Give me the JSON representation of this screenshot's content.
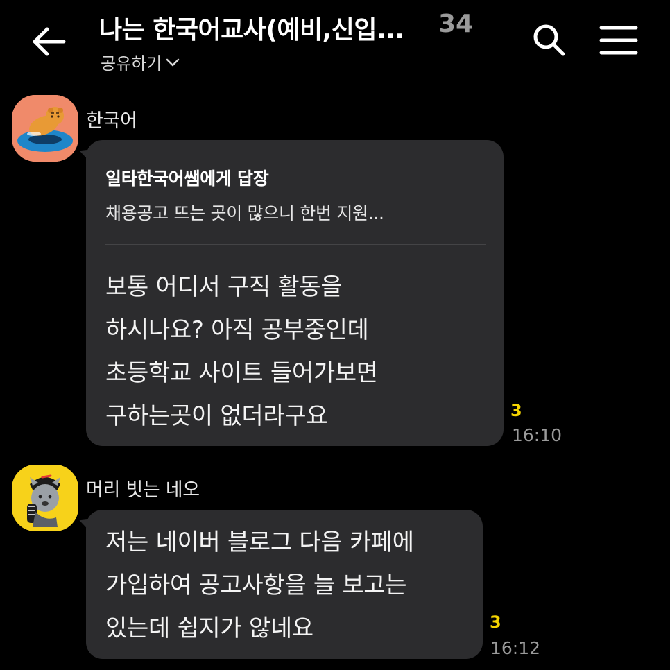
{
  "header": {
    "title": "나는 한국어교사(예비,신입...",
    "member_count": "34",
    "share_label": "공유하기"
  },
  "colors": {
    "background": "#000000",
    "bubble": "#2c2c2e",
    "unread": "#f5d400",
    "avatar1_bg": "#f08a6a",
    "avatar2_bg": "#f7d21a"
  },
  "messages": [
    {
      "sender": "한국어",
      "avatar_icon": "ryan-float-avatar-icon",
      "reply_to": "일타한국어쌤에게 답장",
      "reply_preview": "채용공고 뜨는 곳이 많으니 한번 지원...",
      "text": "보통 어디서 구직 활동을\n하시나요? 아직 공부중인데\n초등학교 사이트 들어가보면\n구하는곳이 없더라구요",
      "unread": "3",
      "time": "16:10"
    },
    {
      "sender": "머리 빗는 네오",
      "avatar_icon": "neo-comb-avatar-icon",
      "text": "저는 네이버 블로그 다음 카페에\n가입하여 공고사항을 늘 보고는\n있는데 쉽지가 않네요",
      "unread": "3",
      "time": "16:12"
    }
  ]
}
